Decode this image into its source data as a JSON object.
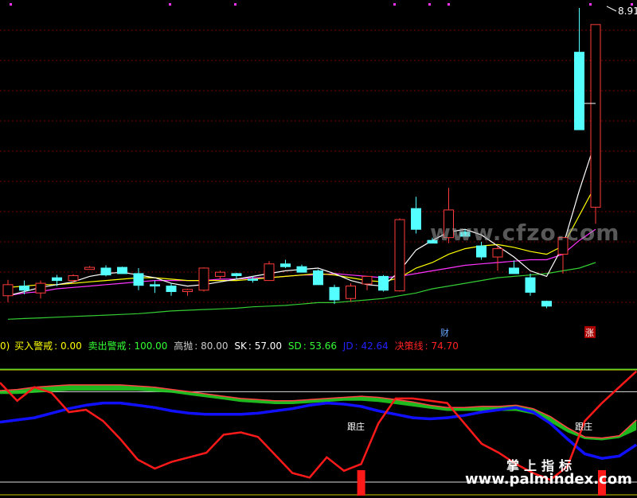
{
  "price_panel": {
    "price_label": "8.91",
    "event_markers": [
      "财",
      "涨"
    ],
    "colors": {
      "up": "#ff3b3b",
      "down": "#54ffff",
      "ma5": "#ffffff",
      "ma10": "#ffff00",
      "ma20": "#ff33ff",
      "ma60": "#33cc33"
    }
  },
  "indicator": {
    "legend": [
      {
        "name": "买入警戒",
        "value": "0.00",
        "color": "#ffff00"
      },
      {
        "name": "卖出警戒",
        "value": "100.00",
        "color": "#33ff33"
      },
      {
        "name": "高抛",
        "value": "80.00",
        "color": "#cccccc"
      },
      {
        "name": "SK",
        "value": "57.00",
        "color": "#ffffff"
      },
      {
        "name": "SD",
        "value": "53.66",
        "color": "#33ff33"
      },
      {
        "name": "JD",
        "value": "42.64",
        "color": "#2222ff"
      },
      {
        "name": "决策线",
        "value": "74.70",
        "color": "#ff2222"
      }
    ],
    "annotations": [
      "跟庄",
      "跟庄"
    ]
  },
  "watermarks": {
    "url": "www.cfzo.com",
    "cn": "掌上指标",
    "site": "www.palmindex.com"
  },
  "chart_data": {
    "type": "candlestick",
    "candles": [
      {
        "o": 22.0,
        "h": 33.5,
        "l": 17.5,
        "c": 30.0
      },
      {
        "o": 29.0,
        "h": 33.0,
        "l": 23.0,
        "c": 26.0
      },
      {
        "o": 24.0,
        "h": 33.0,
        "l": 20.0,
        "c": 31.0
      },
      {
        "o": 35.0,
        "h": 37.0,
        "l": 29.0,
        "c": 33.0
      },
      {
        "o": 33.0,
        "h": 37.5,
        "l": 31.0,
        "c": 36.5
      },
      {
        "o": 41.0,
        "h": 43.5,
        "l": 41.0,
        "c": 42.5
      },
      {
        "o": 42.0,
        "h": 44.0,
        "l": 36.0,
        "c": 37.0
      },
      {
        "o": 42.5,
        "h": 43.0,
        "l": 38.0,
        "c": 38.0
      },
      {
        "o": 38.0,
        "h": 42.0,
        "l": 26.0,
        "c": 29.5
      },
      {
        "o": 30.0,
        "h": 33.0,
        "l": 24.0,
        "c": 29.0
      },
      {
        "o": 29.0,
        "h": 31.0,
        "l": 22.0,
        "c": 25.0
      },
      {
        "o": 25.0,
        "h": 27.0,
        "l": 22.0,
        "c": 26.5
      },
      {
        "o": 26.0,
        "h": 42.5,
        "l": 25.0,
        "c": 42.0
      },
      {
        "o": 36.0,
        "h": 40.0,
        "l": 34.0,
        "c": 39.0
      },
      {
        "o": 38.0,
        "h": 38.5,
        "l": 34.5,
        "c": 36.5
      },
      {
        "o": 34.0,
        "h": 36.0,
        "l": 31.5,
        "c": 33.5
      },
      {
        "o": 33.0,
        "h": 47.0,
        "l": 33.0,
        "c": 45.0
      },
      {
        "o": 45.0,
        "h": 48.0,
        "l": 42.0,
        "c": 43.0
      },
      {
        "o": 43.0,
        "h": 44.5,
        "l": 40.0,
        "c": 39.0
      },
      {
        "o": 40.0,
        "h": 41.0,
        "l": 32.0,
        "c": 30.0
      },
      {
        "o": 28.0,
        "h": 30.0,
        "l": 16.0,
        "c": 19.0
      },
      {
        "o": 20.0,
        "h": 31.0,
        "l": 18.0,
        "c": 29.0
      },
      {
        "o": 30.5,
        "h": 36.0,
        "l": 26.0,
        "c": 36.0
      },
      {
        "o": 36.0,
        "h": 37.0,
        "l": 25.0,
        "c": 26.0
      },
      {
        "o": 25.5,
        "h": 78.0,
        "l": 25.0,
        "c": 77.0
      },
      {
        "o": 85.0,
        "h": 93.5,
        "l": 67.0,
        "c": 70.0
      },
      {
        "o": 62.0,
        "h": 64.0,
        "l": 60.0,
        "c": 60.0
      },
      {
        "o": 64.0,
        "h": 100.0,
        "l": 60.0,
        "c": 84.0
      },
      {
        "o": 68.0,
        "h": 70.0,
        "l": 66.0,
        "c": 65.0
      },
      {
        "o": 58.0,
        "h": 61.0,
        "l": 48.0,
        "c": 50.0
      },
      {
        "o": 50.0,
        "h": 58.0,
        "l": 40.0,
        "c": 56.0
      },
      {
        "o": 42.0,
        "h": 47.5,
        "l": 38.0,
        "c": 38.0
      },
      {
        "o": 35.0,
        "h": 38.0,
        "l": 22.0,
        "c": 24.5
      },
      {
        "o": 18.0,
        "h": 18.5,
        "l": 13.0,
        "c": 14.5
      },
      {
        "o": 52.0,
        "h": 64.0,
        "l": 38.0,
        "c": 64.0
      },
      {
        "o": 198.0,
        "h": 230.0,
        "l": 165.0,
        "c": 142.0
      },
      {
        "o": 86.0,
        "h": 218.0,
        "l": 74.0,
        "c": 218.0
      }
    ],
    "ma5": [
      22,
      25,
      28,
      30,
      32,
      36,
      38,
      39,
      37,
      35,
      31,
      29,
      30,
      32,
      34,
      36,
      38,
      40,
      41,
      42,
      38,
      33,
      30,
      29,
      40,
      55,
      62,
      68,
      70,
      66,
      58,
      50,
      40,
      36,
      58,
      98,
      134
    ],
    "ma10": [
      28,
      29,
      30,
      30,
      31,
      32,
      33,
      34,
      35,
      35,
      34,
      33,
      33,
      33,
      33,
      34,
      35,
      36,
      37,
      38,
      37,
      35,
      33,
      32,
      35,
      42,
      46,
      52,
      56,
      58,
      59,
      57,
      54,
      52,
      58,
      80,
      102
    ],
    "ma20": [
      22,
      24,
      25,
      27,
      28,
      29,
      30,
      31,
      32,
      33,
      33,
      33,
      33,
      34,
      34,
      35,
      35,
      36,
      37,
      37,
      38,
      37,
      36,
      35,
      36,
      38,
      40,
      42,
      44,
      45,
      46,
      47,
      48,
      48,
      52,
      62,
      70
    ],
    "ma60": [
      5,
      5.5,
      6,
      6.5,
      7,
      7.5,
      8,
      8.5,
      9,
      10,
      11,
      11.5,
      12,
      12.5,
      13,
      14,
      14.5,
      15,
      16,
      17,
      17,
      18,
      19,
      20,
      22,
      24,
      27,
      29,
      31,
      33,
      35,
      36,
      37,
      38,
      40,
      42,
      46
    ],
    "indicator_lines": {
      "sk": [
        81,
        82,
        84,
        85,
        86,
        86,
        86,
        86,
        85,
        84,
        82,
        80,
        78,
        76,
        74,
        73,
        72,
        72,
        73,
        74,
        75,
        76,
        75,
        73,
        71,
        68,
        66,
        66,
        67,
        67,
        68,
        65,
        58,
        48,
        40,
        39,
        41,
        55
      ],
      "sd": [
        82,
        82,
        83,
        84,
        85,
        85,
        85,
        85,
        85,
        84,
        83,
        81,
        79,
        77,
        75,
        74,
        73,
        73,
        74,
        75,
        76,
        76,
        75,
        73,
        71,
        69,
        67,
        67,
        67,
        67,
        67,
        64,
        57,
        48,
        42,
        41,
        43,
        50
      ],
      "jd": [
        53,
        55,
        57,
        61,
        65,
        68,
        70,
        70,
        68,
        66,
        63,
        61,
        60,
        60,
        60,
        61,
        63,
        65,
        68,
        70,
        69,
        67,
        63,
        60,
        57,
        56,
        57,
        59,
        62,
        64,
        66,
        62,
        52,
        38,
        25,
        21,
        23,
        33
      ],
      "decision": [
        88,
        72,
        84,
        79,
        62,
        64,
        54,
        38,
        20,
        12,
        18,
        22,
        26,
        42,
        44,
        40,
        24,
        8,
        4,
        22,
        10,
        16,
        52,
        74,
        74,
        72,
        70,
        52,
        34,
        26,
        16,
        8,
        2,
        14,
        54,
        70,
        84,
        98
      ]
    },
    "indicator_levels": {
      "sell_alert": 100,
      "high_throw": 80,
      "buy_alert": 0
    },
    "signal_bars": [
      21,
      35
    ]
  }
}
